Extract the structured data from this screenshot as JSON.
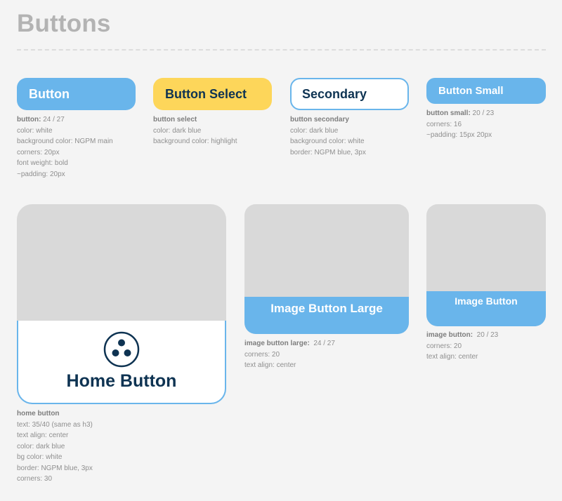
{
  "page": {
    "title": "Buttons"
  },
  "colors": {
    "ngpm_main": "#69b5eb",
    "highlight": "#fdd65a",
    "dark_blue": "#0e3352",
    "white": "#ffffff",
    "placeholder_image": "#d9d9d9"
  },
  "buttons": {
    "main": {
      "label": "Button",
      "desc": {
        "name": "button:",
        "size": " 24 / 27",
        "lines": [
          "color: white",
          "background color: NGPM main",
          "corners: 20px",
          "font weight: bold",
          "~padding: 20px"
        ]
      }
    },
    "select": {
      "label": "Button Select",
      "desc": {
        "name": "button select",
        "size": "",
        "lines": [
          "color: dark blue",
          "background color: highlight"
        ]
      }
    },
    "secondary": {
      "label": "Secondary",
      "desc": {
        "name": "button secondary",
        "size": "",
        "lines": [
          "color: dark blue",
          "background color: white",
          "border: NGPM blue, 3px"
        ]
      }
    },
    "small": {
      "label": "Button Small",
      "desc": {
        "name": "button small:",
        "size": " 20 / 23",
        "lines": [
          "corners: 16",
          "~padding: 15px 20px"
        ]
      }
    }
  },
  "home_button": {
    "label": "Home Button",
    "icon": "three-dots-circle-icon",
    "desc": {
      "name": "home button",
      "lines": [
        "text: 35/40 (same as h3)",
        "text align: center",
        "color: dark blue",
        "bg color: white",
        "border: NGPM blue, 3px",
        "corners: 30"
      ]
    }
  },
  "image_button_large": {
    "label": "Image Button Large",
    "desc": {
      "name": "image button large:",
      "size": "  24 / 27",
      "lines": [
        "corners: 20",
        "text align: center"
      ]
    }
  },
  "image_button": {
    "label": "Image Button",
    "desc": {
      "name": "image button:",
      "size": "  20 / 23",
      "lines": [
        "corners: 20",
        "text align: center"
      ]
    }
  }
}
